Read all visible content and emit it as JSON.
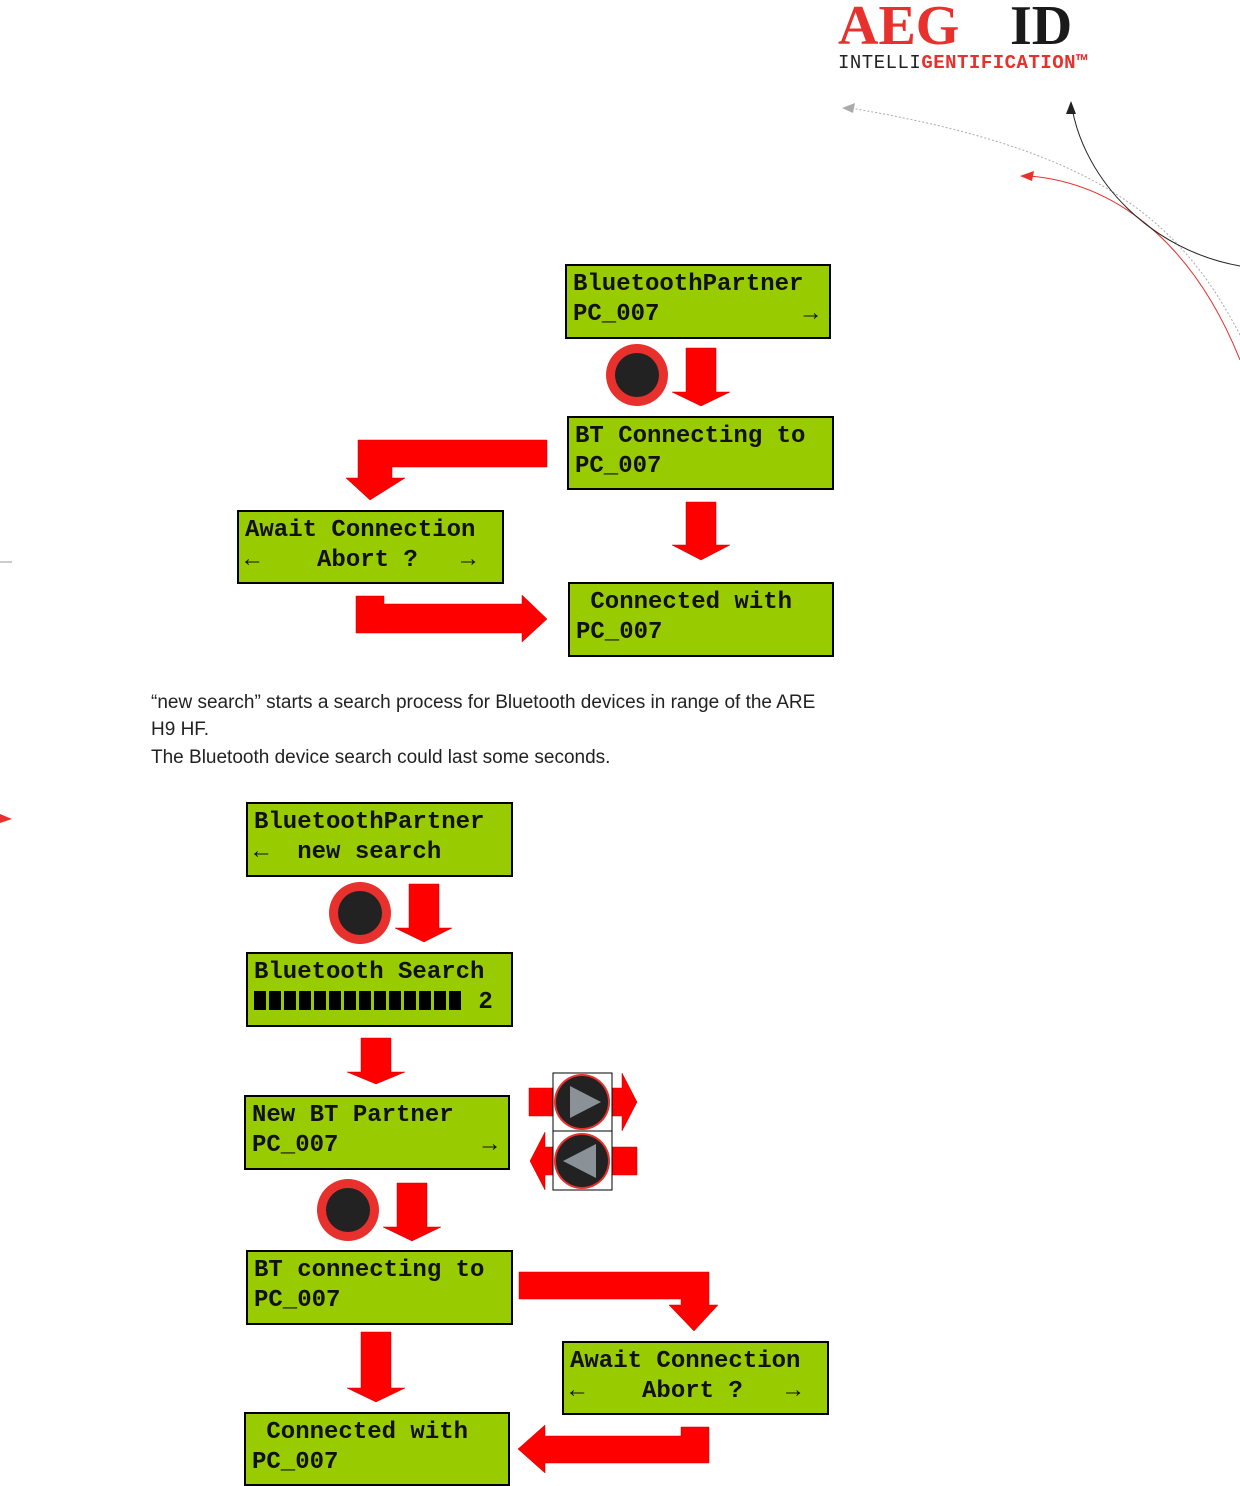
{
  "logo": {
    "brand": "AEG",
    "id": "ID",
    "tagline_a": "INTELLI",
    "tagline_b": "GENTIFICATION™"
  },
  "colors": {
    "lcd": "#99cc00",
    "arrow": "#ff0000",
    "button_ring": "#e8302c"
  },
  "diagram1": {
    "lcd1": [
      "BluetoothPartner",
      "PC_007          →"
    ],
    "lcd2": [
      "BT Connecting to",
      "PC_007"
    ],
    "lcd3": [
      "Await Connection",
      "←    Abort ?   →"
    ],
    "lcd4": [
      " Connected with",
      "PC_007"
    ]
  },
  "paragraph": {
    "line1": "“new search” starts a search process for Bluetooth devices in range of the ARE",
    "line2": "H9 HF.",
    "line3": "The Bluetooth device search could last some seconds."
  },
  "diagram2": {
    "lcd5": [
      "BluetoothPartner",
      "←  new search"
    ],
    "lcd6": {
      "title": "Bluetooth Search",
      "progress_blocks": 14,
      "count": "2"
    },
    "lcd7": [
      "New BT Partner",
      "PC_007          →"
    ],
    "lcd8": [
      "BT connecting to",
      "PC_007"
    ],
    "lcd9": [
      "Await Connection",
      "←    Abort ?   →"
    ],
    "lcd10": [
      " Connected with",
      "PC_007"
    ]
  },
  "icons": {
    "select": "round-select-button",
    "next": "right-triangle-button",
    "prev": "left-triangle-button"
  }
}
